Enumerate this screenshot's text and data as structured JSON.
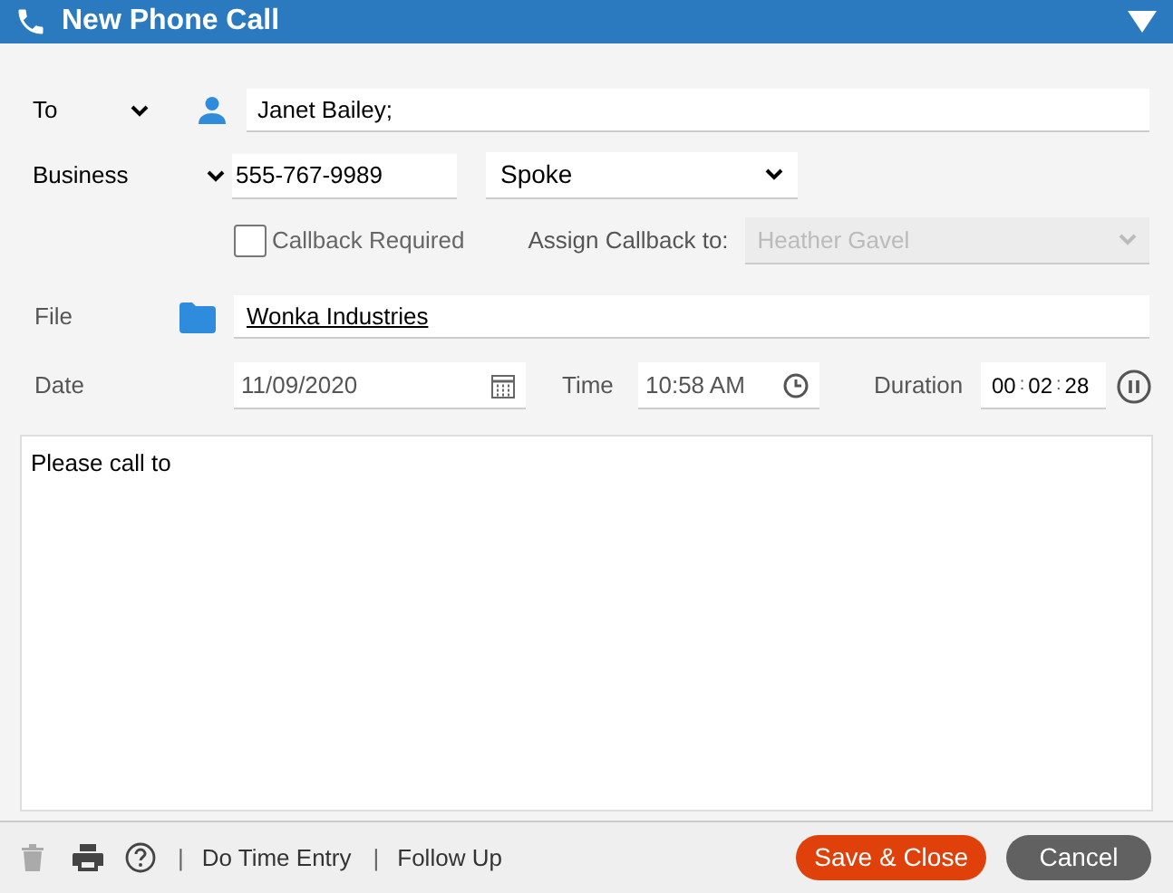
{
  "window": {
    "title": "New Phone Call"
  },
  "to": {
    "label": "To",
    "value": "Janet Bailey;"
  },
  "phone": {
    "type": "Business",
    "number": "555-767-9989",
    "result": "Spoke"
  },
  "callback": {
    "label": "Callback Required",
    "checked": false,
    "assign_label": "Assign Callback to:",
    "assignee": "Heather Gavel",
    "disabled": true
  },
  "file": {
    "label": "File",
    "value": "Wonka Industries"
  },
  "date": {
    "label": "Date",
    "value": "11/09/2020"
  },
  "time": {
    "label": "Time",
    "value": "10:58 AM"
  },
  "duration": {
    "label": "Duration",
    "parts": [
      "00",
      "02",
      "28"
    ],
    "separator": ":",
    "paused": false
  },
  "notes": {
    "value": "Please call to"
  },
  "footer": {
    "delete_disabled": true,
    "links": [
      "Do Time Entry",
      "Follow Up"
    ],
    "separator": "|",
    "buttons": [
      "Save & Close",
      "Cancel"
    ]
  }
}
